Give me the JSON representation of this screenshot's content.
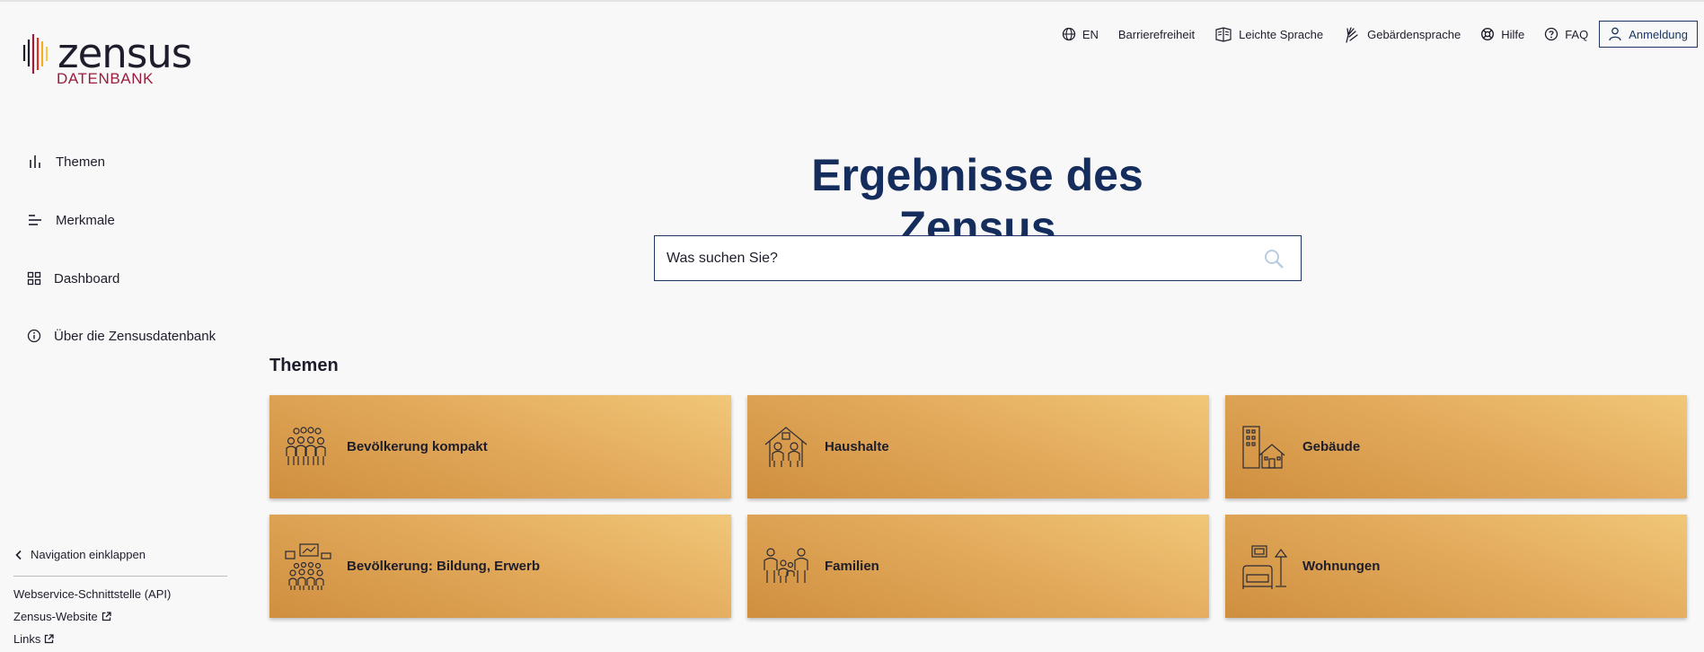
{
  "logo": {
    "word": "zensus",
    "sub": "DATENBANK"
  },
  "topnav": {
    "language": "EN",
    "accessibility": "Barrierefreiheit",
    "easy_language": "Leichte Sprache",
    "sign_language": "Gebärdensprache",
    "help": "Hilfe",
    "faq": "FAQ",
    "login": "Anmeldung"
  },
  "sidebar": {
    "items": [
      {
        "label": "Themen",
        "icon": "bar-chart-icon"
      },
      {
        "label": "Merkmale",
        "icon": "lines-icon"
      },
      {
        "label": "Dashboard",
        "icon": "grid-icon"
      },
      {
        "label": "Über die Zensusdatenbank",
        "icon": "info-icon"
      }
    ],
    "collapse": "Navigation einklappen",
    "links": [
      "Webservice-Schnittstelle (API)",
      "Zensus-Website",
      "Links"
    ]
  },
  "main": {
    "title": "Ergebnisse des Zensus",
    "search_placeholder": "Was suchen Sie?",
    "section_title": "Themen",
    "tiles": [
      {
        "label": "Bevölkerung kompakt",
        "icon": "people-group-icon"
      },
      {
        "label": "Haushalte",
        "icon": "household-icon"
      },
      {
        "label": "Gebäude",
        "icon": "buildings-icon"
      },
      {
        "label": "Bevölkerung: Bildung, Erwerb",
        "icon": "education-work-icon"
      },
      {
        "label": "Familien",
        "icon": "family-icon"
      },
      {
        "label": "Wohnungen",
        "icon": "apartment-icon"
      }
    ]
  },
  "colors": {
    "accent": "#142d5c",
    "brand_red": "#9b1c3c",
    "tile_gold": "#e3aa5c"
  }
}
